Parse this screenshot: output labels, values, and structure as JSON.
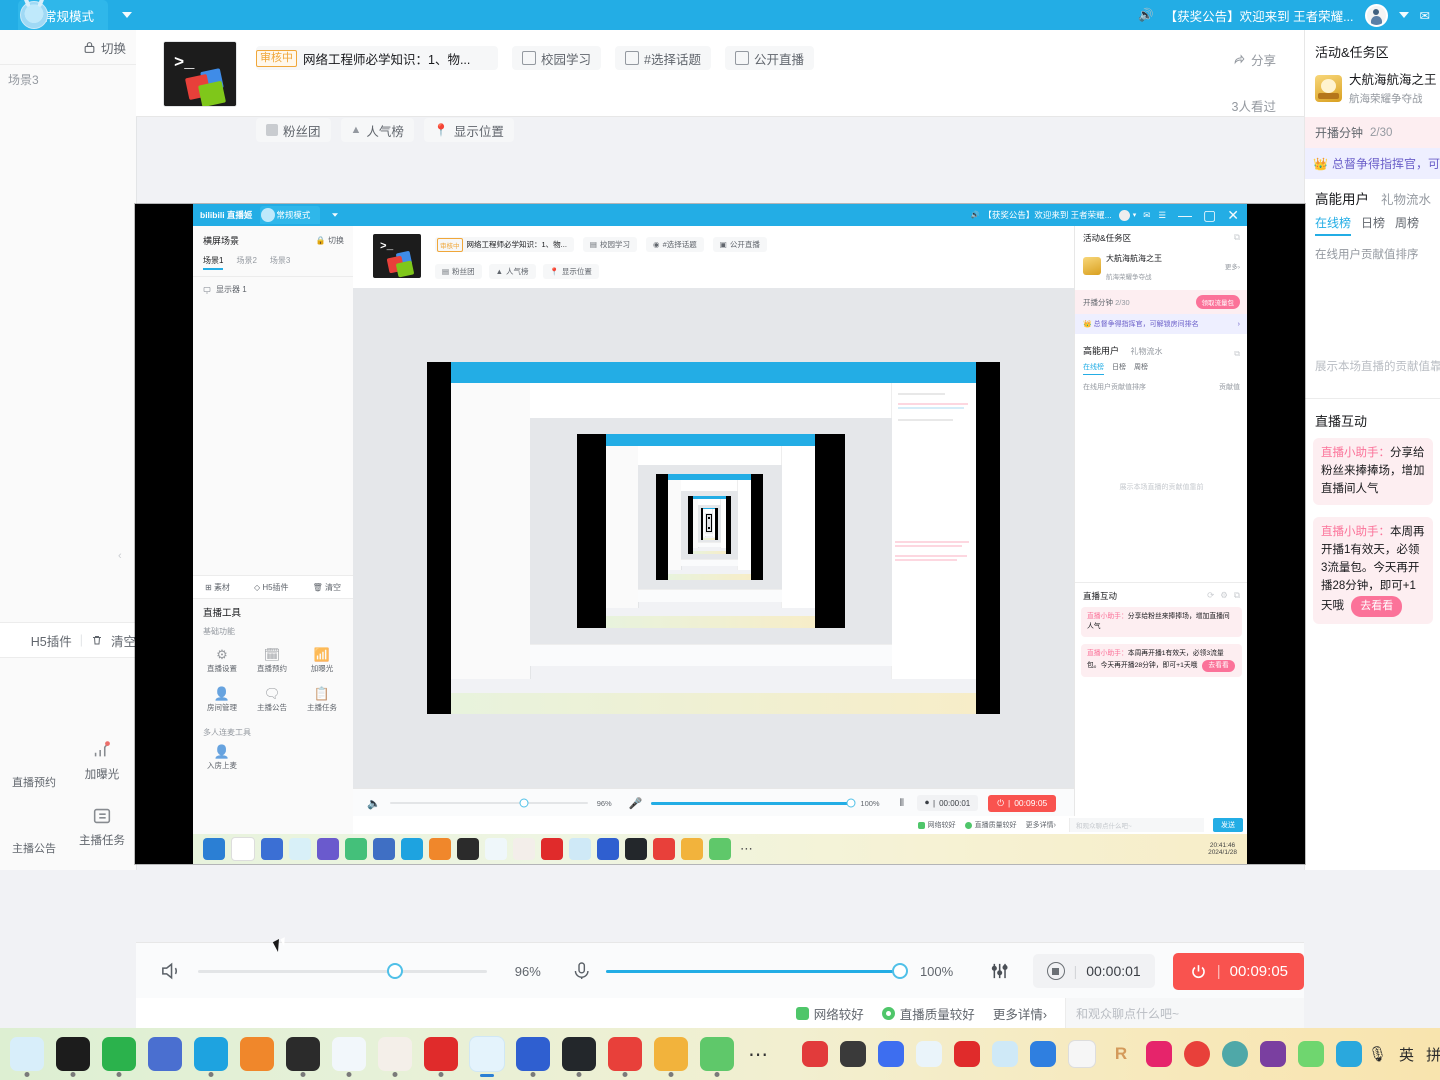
{
  "app": {
    "brand": "bilibili 直播姬",
    "mode_tab": "常规模式",
    "announcement": "【获奖公告】欢迎来到 王者荣耀...",
    "window_controls": {
      "minimize": "—",
      "maximize": "▢",
      "close": "✕"
    }
  },
  "sidebar": {
    "scene_title": "横屏场景",
    "switch_label": "切换",
    "scene_tabs": [
      "场景1",
      "场景2",
      "场景3"
    ],
    "source_item": "显示器 1",
    "add_material": "素材",
    "h5_plugin": "H5插件",
    "clear": "清空",
    "tools_title": "直播工具",
    "basic_group": "基础功能",
    "multi_group": "多人连麦工具",
    "tools": [
      {
        "label": "直播设置",
        "icon": "gear-icon"
      },
      {
        "label": "直播预约",
        "icon": "calendar-icon"
      },
      {
        "label": "加曝光",
        "icon": "bar-chart-icon"
      },
      {
        "label": "房间管理",
        "icon": "user-manage-icon"
      },
      {
        "label": "主播公告",
        "icon": "announcement-icon"
      },
      {
        "label": "主播任务",
        "icon": "task-list-icon"
      }
    ],
    "multi_tools": [
      {
        "label": "入房上麦",
        "icon": "user-join-icon"
      }
    ]
  },
  "header": {
    "audit_badge": "审核中",
    "room_title": "网络工程师必学知识：1、物...",
    "chips": [
      {
        "label": "校园学习",
        "icon": "book-icon"
      },
      {
        "label": "#选择话题",
        "icon": "hash-icon"
      },
      {
        "label": "公开直播",
        "icon": "broadcast-icon"
      }
    ],
    "meta_chips": [
      {
        "label": "粉丝团",
        "icon": "fanclub-icon"
      },
      {
        "label": "人气榜",
        "icon": "fire-icon"
      },
      {
        "label": "显示位置",
        "icon": "location-icon"
      }
    ],
    "share_label": "分享",
    "viewers": "3人看过"
  },
  "right_panel": {
    "activity_title": "活动&任务区",
    "activity_name": "大航海航海之王",
    "activity_sub": "航海荣耀争夺战",
    "more": "更多",
    "stream_minutes_label": "开播分钟",
    "stream_minutes_value": "2/30",
    "claim_button": "领取流量包",
    "commander_text": "总督争得指挥官，可解锁房间排名",
    "tab_high_energy": "高能用户",
    "tab_gift_flow": "礼物流水",
    "subtabs": [
      "在线榜",
      "日榜",
      "周榜"
    ],
    "contrib_hint": "在线用户贡献值排序",
    "contrib_link": "贡献值",
    "empty_text": "展示本场直播的贡献值靠前",
    "chat_title": "直播互动",
    "messages": [
      {
        "sender": "直播小助手：",
        "text": "分享给粉丝来捧捧场，增加直播间人气"
      },
      {
        "sender": "直播小助手：",
        "text": "本周再开播1有效天，必领3流量包。今天再开播28分钟，即可+1天哦",
        "button": "去看看"
      }
    ]
  },
  "controls": {
    "speaker_icon": "speaker-icon",
    "speaker_percent": "96%",
    "speaker_value": 96,
    "mic_icon": "microphone-icon",
    "mic_percent": "100%",
    "mic_value": 100,
    "mixer_icon": "audio-mixer-icon",
    "record_time": "00:00:01",
    "live_time": "00:09:05",
    "record_icon": "record-icon",
    "power_icon": "power-icon"
  },
  "status_bar": {
    "network": "网络较好",
    "quality": "直播质量较好",
    "more_details": "更多详情",
    "chat_placeholder": "和观众聊点什么吧~",
    "send_label": "发送"
  },
  "system": {
    "clock_time": "20:41:46",
    "clock_date": "2024/1/28",
    "ime_en": "英",
    "ime_pin": "拼"
  },
  "colors": {
    "brand_blue": "#23ade5",
    "pink": "#fb7299",
    "danger_red": "#f9534f",
    "audit_orange": "#f0a73a",
    "green": "#4fc66a"
  }
}
